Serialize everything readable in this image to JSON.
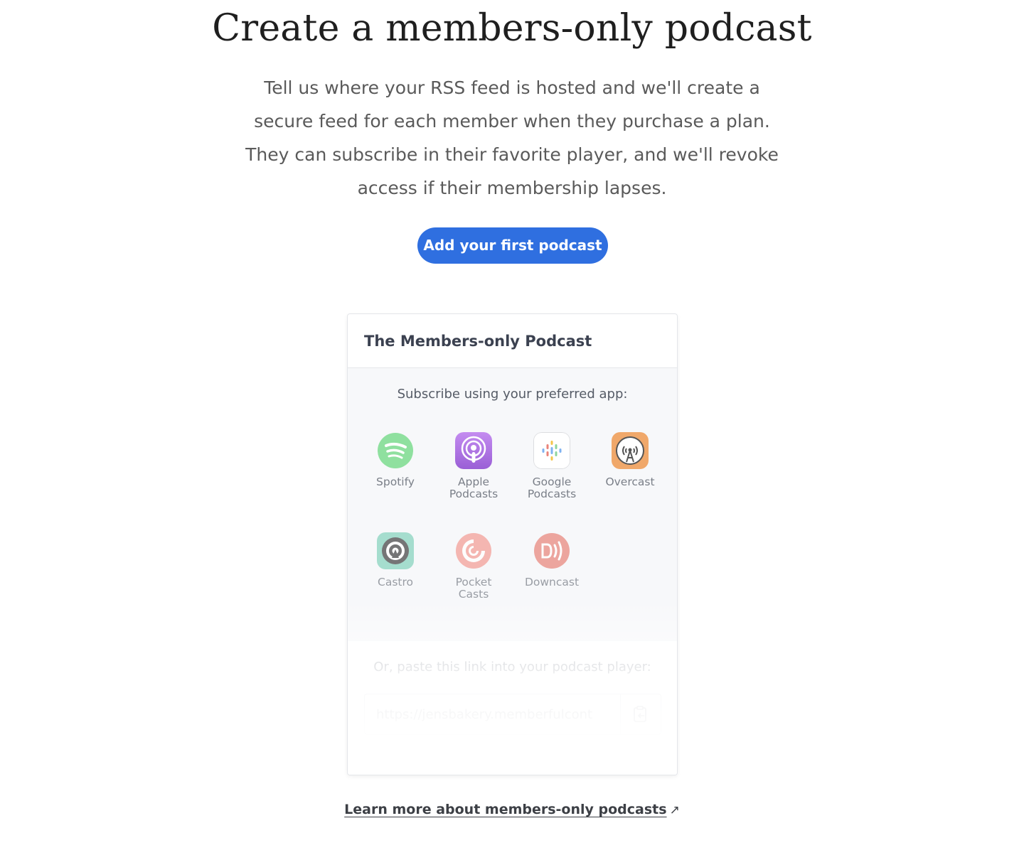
{
  "heading": "Create a members-only podcast",
  "intro_lines": [
    "Tell us where your RSS feed is hosted and we'll create a",
    "secure feed for each member when they purchase a plan.",
    "They can subscribe in their favorite player, and we'll revoke",
    "access if their membership lapses."
  ],
  "cta_label": "Add your first podcast",
  "card": {
    "title": "The Members-only Podcast",
    "subscribe_label": "Subscribe using your preferred app:",
    "apps": [
      {
        "name": "Spotify",
        "label": "Spotify",
        "icon": "spotify-icon"
      },
      {
        "name": "Apple Podcasts",
        "label": "Apple\nPodcasts",
        "icon": "apple-podcasts-icon"
      },
      {
        "name": "Google Podcasts",
        "label": "Google\nPodcasts",
        "icon": "google-podcasts-icon"
      },
      {
        "name": "Overcast",
        "label": "Overcast",
        "icon": "overcast-icon"
      },
      {
        "name": "Castro",
        "label": "Castro",
        "icon": "castro-icon"
      },
      {
        "name": "Pocket Casts",
        "label": "Pocket\nCasts",
        "icon": "pocket-casts-icon"
      },
      {
        "name": "Downcast",
        "label": "Downcast",
        "icon": "downcast-icon"
      }
    ],
    "paste_label": "Or, paste this link into your podcast player:",
    "feed_url": "https://jensbakery.memberfulcont",
    "copy_icon": "clipboard-icon"
  },
  "learn_more_label": "Learn more about members-only podcasts",
  "learn_more_icon": "external-arrow-icon",
  "colors": {
    "primary": "#2f6fe0",
    "spotify": "#8fe09f",
    "apple": "#b57ce4",
    "overcast": "#f0a86a",
    "castro": "#8ad5c0",
    "pocket_casts": "#f3a099",
    "downcast": "#e98a80"
  }
}
